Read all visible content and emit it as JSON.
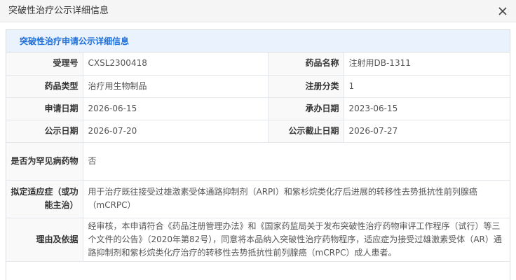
{
  "dialog": {
    "title": "突破性治疗公示详细信息",
    "close_icon": "close-icon"
  },
  "panel": {
    "title": "突破性治疗申请公示详细信息"
  },
  "fields": {
    "acceptance_no_label": "受理号",
    "acceptance_no": "CXSL2300418",
    "drug_name_label": "药品名称",
    "drug_name": "注射用DB-1311",
    "drug_type_label": "药品类型",
    "drug_type": "治疗用生物制品",
    "reg_class_label": "注册分类",
    "reg_class": "1",
    "apply_date_label": "申请日期",
    "apply_date": "2026-06-15",
    "handle_date_label": "承办日期",
    "handle_date": "2023-06-15",
    "publish_date_label": "公示日期",
    "publish_date": "2026-07-20",
    "publish_end_label": "公示截止日期",
    "publish_end": "2026-07-27",
    "rare_disease_label": "是否为罕见病药物",
    "rare_disease": "否",
    "indication_label": "拟定适应症（或功能主治）",
    "indication": "用于治疗既往接受过雄激素受体通路抑制剂（ARPI）和紫杉烷类化疗后进展的转移性去势抵抗性前列腺癌（mCRPC）",
    "reason_label": "理由及依据",
    "reason": "经审核，本申请符合《药品注册管理办法》和《国家药监局关于发布突破性治疗药物审评工作程序（试行）等三个文件的公告》（2020年第82号），同意将本品纳入突破性治疗药物程序，适应症为接受过雄激素受体（AR）通路抑制剂和紫杉烷类化疗治疗的转移性去势抵抗性前列腺癌（mCRPC）成人患者。"
  },
  "colors": {
    "accent": "#1e6fd9",
    "panel_header_bg": "#eaf2fd",
    "label_bg": "#f9f9f9",
    "border": "#e3e6ea"
  }
}
